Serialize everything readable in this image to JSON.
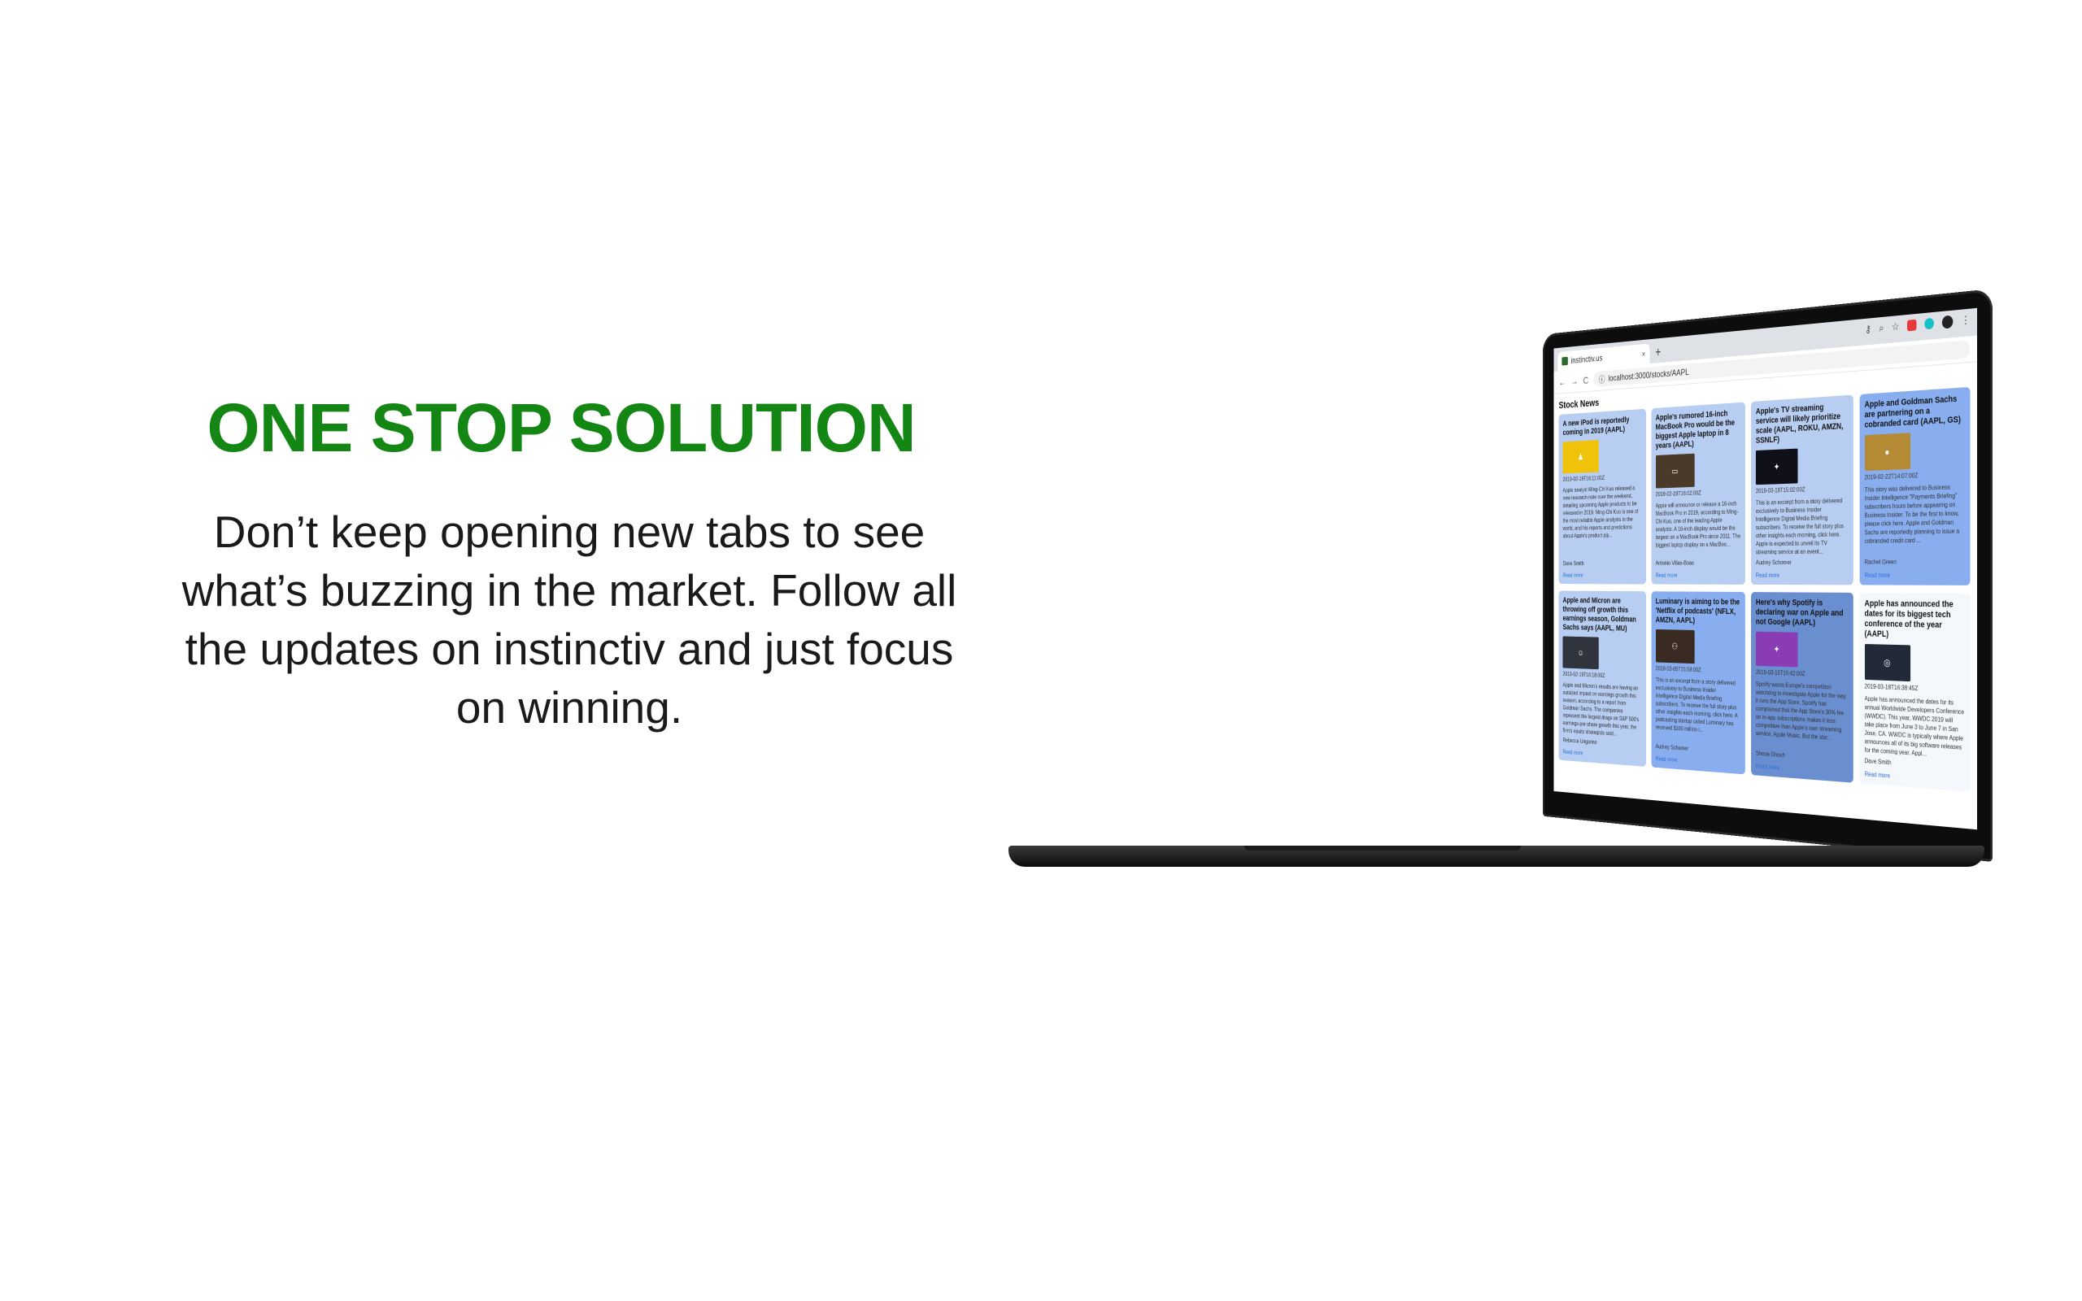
{
  "hero": {
    "title": "ONE STOP SOLUTION",
    "title_color": "#138613",
    "text": "Don’t keep opening new tabs to see what’s buzzing in the market. Follow all the updates on instinctiv and just focus on winning.",
    "text_color": "#1a1a1a"
  },
  "browser": {
    "tab_title": "instinctiv.us",
    "tab_close": "×",
    "new_tab": "+",
    "back": "←",
    "forward": "→",
    "reload": "C",
    "url": "localhost:3000/stocks/AAPL",
    "ext_icons": [
      "key",
      "search",
      "star"
    ]
  },
  "page": {
    "heading": "Stock News",
    "cards": [
      {
        "title": "A new iPod is reportedly coming in 2019 (AAPL)",
        "date": "2019-02-19T16:11:00Z",
        "body": "Apple analyst Ming-Chi Kuo released a new research note over the weekend, detailing upcoming Apple products to be released in 2019. Ming-Chi Kuo is one of the most reliable Apple analysts in the world, and his reports and predictions about Apple's product pip...",
        "author": "Dave Smith",
        "read": "Read more",
        "bg": "#b7cdf2",
        "thumb_bg": "#f0c20a",
        "thumb_icon": "person-silhouette-icon"
      },
      {
        "title": "Apple's rumored 16-inch MacBook Pro would be the biggest Apple laptop in 8 years (AAPL)",
        "date": "2019-02-19T16:02:00Z",
        "body": "Apple will announce or release a 16-inch MacBook Pro in 2019, according to Ming-Chi Kuo, one of the leading Apple analysts. A 16-inch display would be the largest on a MacBook Pro since 2011. The biggest laptop display on a MacBoo...",
        "author": "Antonio Villas-Boas",
        "read": "Read more",
        "bg": "#b7cdf2",
        "thumb_bg": "#4a3a2a",
        "thumb_icon": "laptop-icon"
      },
      {
        "title": "Apple's TV streaming service will likely prioritize scale (AAPL, ROKU, AMZN, SSNLF)",
        "date": "2019-03-19T15:02:00Z",
        "body": "This is an excerpt from a story delivered exclusively to Business Insider Intelligence Digital Media Briefing subscribers. To receive the full story plus other insights each morning, click here. Apple is expected to unveil its TV streaming service at an event...",
        "author": "Audrey Schomer",
        "read": "Read more",
        "bg": "#b7cdf2",
        "thumb_bg": "#101018",
        "thumb_icon": "stage-icon"
      },
      {
        "title": "Apple and Goldman Sachs are partnering on a cobranded card (AAPL, GS)",
        "date": "2019-02-22T14:07:00Z",
        "body": "This story was delivered to Business Insider Intelligence \"Payments Briefing\" subscribers hours before appearing on Business Insider. To be the first to know, please click here. Apple and Goldman Sachs are reportedly planning to issue a cobranded credit card ...",
        "author": "Rachel Green",
        "read": "Read more",
        "bg": "#88aef0",
        "thumb_bg": "#b48a34",
        "thumb_icon": "apple-logo-icon"
      },
      {
        "title": "Apple and Micron are throwing off growth this earnings season, Goldman Sachs says (AAPL, MU)",
        "date": "2019-02-19T16:18:00Z",
        "body": "Apple and Micron's results are having an outsized impact on earnings growth this season, according to a report from Goldman Sachs. The companies represent the largest drags on S&P 500's earnings-per-share growth this year, the firm's equity strategists said...",
        "author": "Rebecca Ungarino",
        "read": "Read more",
        "bg": "#b7cdf2",
        "thumb_bg": "#30343c",
        "thumb_icon": "person-icon"
      },
      {
        "title": "Luminary is aiming to be the 'Netflix of podcasts' (NFLX, AMZN, AAPL)",
        "date": "2019-03-05T15:58:00Z",
        "body": "This is an excerpt from a story delivered exclusively to Business Insider Intelligence Digital Media Briefing subscribers. To receive the full story plus other insights each morning, click here. A podcasting startup called Luminary has received $100 million i...",
        "author": "Audrey Schomer",
        "read": "Read more",
        "bg": "#88aef0",
        "thumb_bg": "#3a2b22",
        "thumb_icon": "people-icon"
      },
      {
        "title": "Here's why Spotify is declaring war on Apple and not Google (AAPL)",
        "date": "2019-03-15T15:42:00Z",
        "body": "Spotify wants Europe's competition watchdog to investigate Apple for the way it runs the App Store. Spotify has complained that the App Store's 30% fee on in-app subscriptions makes it less competitive than Apple's own streaming service, Apple Music. But the stor...",
        "author": "Shona Ghosh",
        "read": "Read more",
        "bg": "#6a8fd0",
        "thumb_bg": "#8a3cb4",
        "thumb_icon": "stage-icon"
      },
      {
        "title": "Apple has announced the dates for its biggest tech conference of the year (AAPL)",
        "date": "2019-03-18T16:38:45Z",
        "body": "Apple has announced the dates for its annual Worldwide Developers Conference (WWDC). This year, WWDC 2019 will take place from June 3 to June 7 in San Jose, CA. WWDC is typically where Apple announces all of its big software releases for the coming year. Appl...",
        "author": "Dave Smith",
        "read": "Read more",
        "bg": "#f4f7fc",
        "thumb_bg": "#222a3a",
        "thumb_icon": "globe-icon"
      }
    ]
  }
}
